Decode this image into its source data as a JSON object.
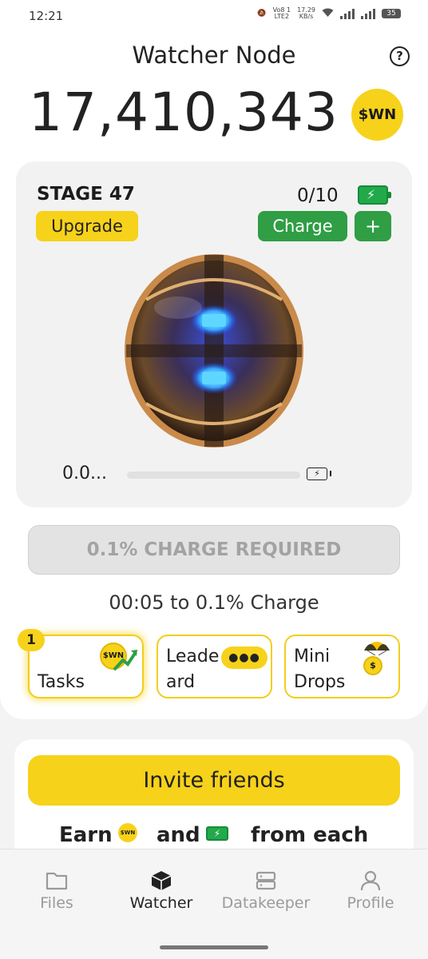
{
  "status_bar": {
    "time": "12:21",
    "network_label_top": "Vo8 1",
    "network_label_bottom": "LTE2",
    "speed_top": "17.29",
    "speed_bottom": "KB/s",
    "battery": "35"
  },
  "header": {
    "title": "Watcher Node",
    "help_icon": "help-circle-icon",
    "help_glyph": "?",
    "balance": "17,410,343",
    "coin_label": "$WN"
  },
  "stage": {
    "label": "STAGE 47",
    "energy": "0/10",
    "upgrade_label": "Upgrade",
    "charge_label": "Charge",
    "plus_label": "+",
    "progress_label": "0.0...",
    "progress_fraction": 0.0
  },
  "charge_required": "0.1% CHARGE REQUIRED",
  "timer": "00:05 to 0.1% Charge",
  "tiles": {
    "badge": "1",
    "tasks": "Tasks",
    "tasks_coin": "$WN",
    "leaderboard_line1": "Leade",
    "leaderboard_line2": "ard",
    "drops_line1": "Mini",
    "drops_line2": "Drops",
    "drops_coin": "$"
  },
  "invite": {
    "button": "Invite friends",
    "earn_word": "Earn",
    "and_word": "and",
    "from_each": "from each",
    "coin_label": "$WN"
  },
  "nav": {
    "items": [
      {
        "label": "Files",
        "icon": "folder-icon"
      },
      {
        "label": "Watcher",
        "icon": "cube-icon"
      },
      {
        "label": "Datakeeper",
        "icon": "server-icon"
      },
      {
        "label": "Profile",
        "icon": "user-icon"
      }
    ],
    "active": "Watcher"
  },
  "colors": {
    "accent_yellow": "#f7d21a",
    "green": "#2f9e44",
    "disabled_gray": "#a3a3a3"
  }
}
